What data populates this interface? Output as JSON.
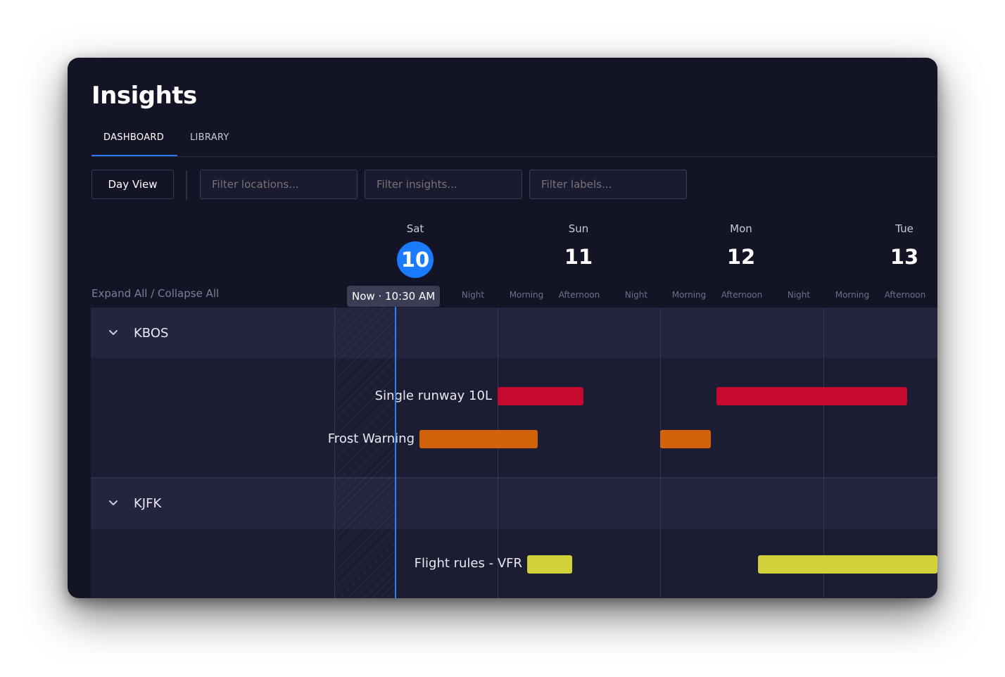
{
  "app": {
    "title": "Insights"
  },
  "tabs": [
    {
      "label": "DASHBOARD",
      "active": true
    },
    {
      "label": "LIBRARY",
      "active": false
    }
  ],
  "toolbar": {
    "view_button": "Day View",
    "filters": {
      "locations_placeholder": "Filter locations...",
      "insights_placeholder": "Filter insights...",
      "labels_placeholder": "Filter labels..."
    }
  },
  "timeline": {
    "days": [
      {
        "name": "Sat",
        "number": "10",
        "today": true
      },
      {
        "name": "Sun",
        "number": "11",
        "today": false
      },
      {
        "name": "Mon",
        "number": "12",
        "today": false
      },
      {
        "name": "Tue",
        "number": "13",
        "today": false
      }
    ],
    "slots": [
      "Night",
      "Morning",
      "Afternoon",
      "Night",
      "Morning",
      "Afternoon",
      "Night",
      "Morning",
      "Afternoon"
    ],
    "expand_collapse": "Expand All / Collapse All",
    "now_label": "Now · 10:30 AM"
  },
  "groups": [
    {
      "code": "KBOS",
      "rows": [
        {
          "label": "Single runway 10L",
          "color": "#c5092f"
        },
        {
          "label": "Frost Warning",
          "color": "#d0630b"
        }
      ]
    },
    {
      "code": "KJFK",
      "rows": [
        {
          "label": "Flight rules - VFR",
          "color": "#d3d13a"
        }
      ]
    }
  ],
  "colors": {
    "accent": "#2d7ff9",
    "today_circle": "#1a7bff",
    "background": "#141427"
  }
}
